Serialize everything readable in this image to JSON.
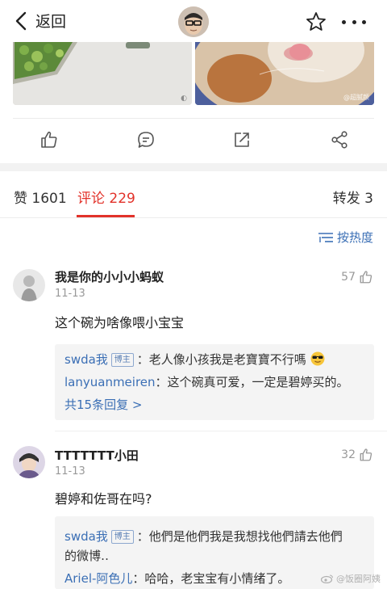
{
  "nav": {
    "back_label": "返回"
  },
  "photos": {
    "watermark_left": "◐",
    "watermark_right": "@超腻颜"
  },
  "tabs": {
    "likes": "赞 1601",
    "comments": "评论 229",
    "reposts": "转发 3"
  },
  "sort": {
    "label": "按热度"
  },
  "comments": [
    {
      "user": "我是你的小小小蚂蚁",
      "time": "11-13",
      "likes": "57",
      "text": "这个碗为啥像喂小宝宝",
      "replies": [
        {
          "user": "swda我",
          "badge": "博主",
          "text": "：老人像小孩我是老寶寶不行嗎"
        },
        {
          "user": "lanyuanmeiren",
          "text": "：这个碗真可爱，一定是碧婷买的。"
        }
      ],
      "more": "共15条回复 >"
    },
    {
      "user": "TTTTTTT小田",
      "time": "11-13",
      "likes": "32",
      "text": "碧婷和佐哥在吗?",
      "replies": [
        {
          "user": "swda我",
          "badge": "博主",
          "text": "：他們是他們我是我想找他們請去他們",
          "text2": "的微博‥"
        },
        {
          "user": "Ariel-阿色儿",
          "text": "：哈哈，老宝宝有小情绪了。"
        }
      ]
    }
  ],
  "watermark": "@饭圈阿姨",
  "icons": [
    "back-chevron-icon",
    "star-icon",
    "more-dots-icon",
    "thumb-up-icon",
    "comment-icon",
    "share-out-icon",
    "share-nodes-icon",
    "sort-lines-icon",
    "sunglasses-emoji-icon",
    "weibo-logo-icon"
  ]
}
